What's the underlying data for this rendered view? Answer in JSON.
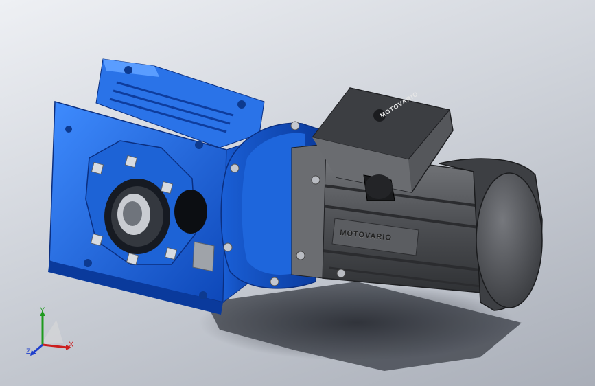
{
  "viewport": {
    "content": "gearmotor-3d-model",
    "background_colors": [
      "#eef0f4",
      "#a9aeb8"
    ]
  },
  "model": {
    "brand_label": "MOTOVARIO",
    "gearbox_color": "#1f6fe0",
    "motor_color": "#4a4c4f"
  },
  "triad": {
    "x_label": "X",
    "y_label": "Y",
    "z_label": "Z",
    "x_color": "#cc1f1f",
    "y_color": "#1f9a1f",
    "z_color": "#1f3fcc"
  }
}
